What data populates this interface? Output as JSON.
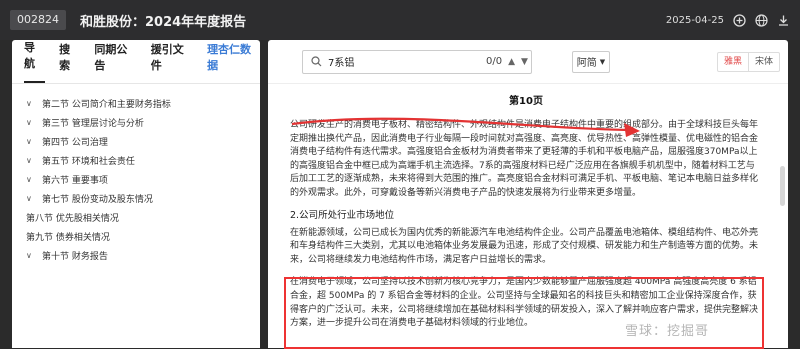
{
  "header": {
    "code": "002824",
    "title": "和胜股份：2024年年度报告",
    "date": "2025-04-25"
  },
  "sidebar": {
    "tabs": [
      {
        "label": "导航"
      },
      {
        "label": "搜索"
      },
      {
        "label": "同期公告"
      },
      {
        "label": "援引文件"
      },
      {
        "label": "理杏仁数据"
      }
    ],
    "toc": [
      {
        "label": "第二节 公司简介和主要财务指标",
        "expandable": true
      },
      {
        "label": "第三节 管理层讨论与分析",
        "expandable": true
      },
      {
        "label": "第四节 公司治理",
        "expandable": true
      },
      {
        "label": "第五节 环境和社会责任",
        "expandable": true
      },
      {
        "label": "第六节 重要事项",
        "expandable": true
      },
      {
        "label": "第七节 股份变动及股东情况",
        "expandable": true
      },
      {
        "label": "第八节 优先股相关情况",
        "expandable": false
      },
      {
        "label": "第九节 债券相关情况",
        "expandable": false
      },
      {
        "label": "第十节 财务报告",
        "expandable": true
      }
    ]
  },
  "reader": {
    "search": {
      "value": "7系铝",
      "count": "0/0"
    },
    "font_select": "阿简",
    "font_toggle": {
      "option1": "雅黑",
      "option2": "宋体"
    },
    "page_label": "第10页",
    "paragraphs": {
      "p1": "公司研发生产的消费电子板材、精密结构件、外观结构件是消费电子结构件中重要的组成部分。由于全球科技巨头每年定期推出换代产品，因此消费电子行业每隔一段时间就对高强度、高亮度、优导热性、高弹性模量、优电磁性的铝合金消费电子结构件有迭代需求。高强度铝合金板材为消费者带来了更轻薄的手机和平板电脑产品，屈服强度370MPa以上的高强度铝合金中框已成为高端手机主流选择。7系的高强度材料已经广泛应用在各旗舰手机机型中，随着材料工艺与后加工工艺的逐渐成熟，未来将得到大范围的推广。高亮度铝合金材料可满足手机、平板电脑、笔记本电脑日益多样化的外观需求。此外，可穿戴设备等新兴消费电子产品的快速发展将为行业带来更多增量。",
      "h2": "2.公司所处行业市场地位",
      "p2": "在新能源领域，公司已成长为国内优秀的新能源汽车电池结构件企业。公司产品覆盖电池箱体、模组结构件、电芯外壳和车身结构件三大类别，尤其以电池箱体业务发展最为迅速，形成了交付规模、研发能力和生产制造等方面的优势。未来，公司将继续发力电池结构件市场，满足客户日益增长的需求。",
      "p3": "在消费电子领域，公司坚持以技术创新为核心竞争力，是国内少数能够量产屈服强度超 400MPa 高强度高亮度 6 系铝合金，超 500MPa 的 7 系铝合金等材料的企业。公司坚持与全球最知名的科技巨头和精密加工企业保持深度合作，获得客户的广泛认可。未来，公司将继续增加在基础材料科学领域的研发投入，深入了解并响应客户需求，提供完整解决方案，进一步提升公司在消费电子基础材料领域的行业地位。"
    }
  },
  "watermark": "雪球：挖掘哥",
  "colors": {
    "annotation_red": "#e33333",
    "link_blue": "#3a7bd5",
    "dark_bg": "#2b2b2b"
  }
}
